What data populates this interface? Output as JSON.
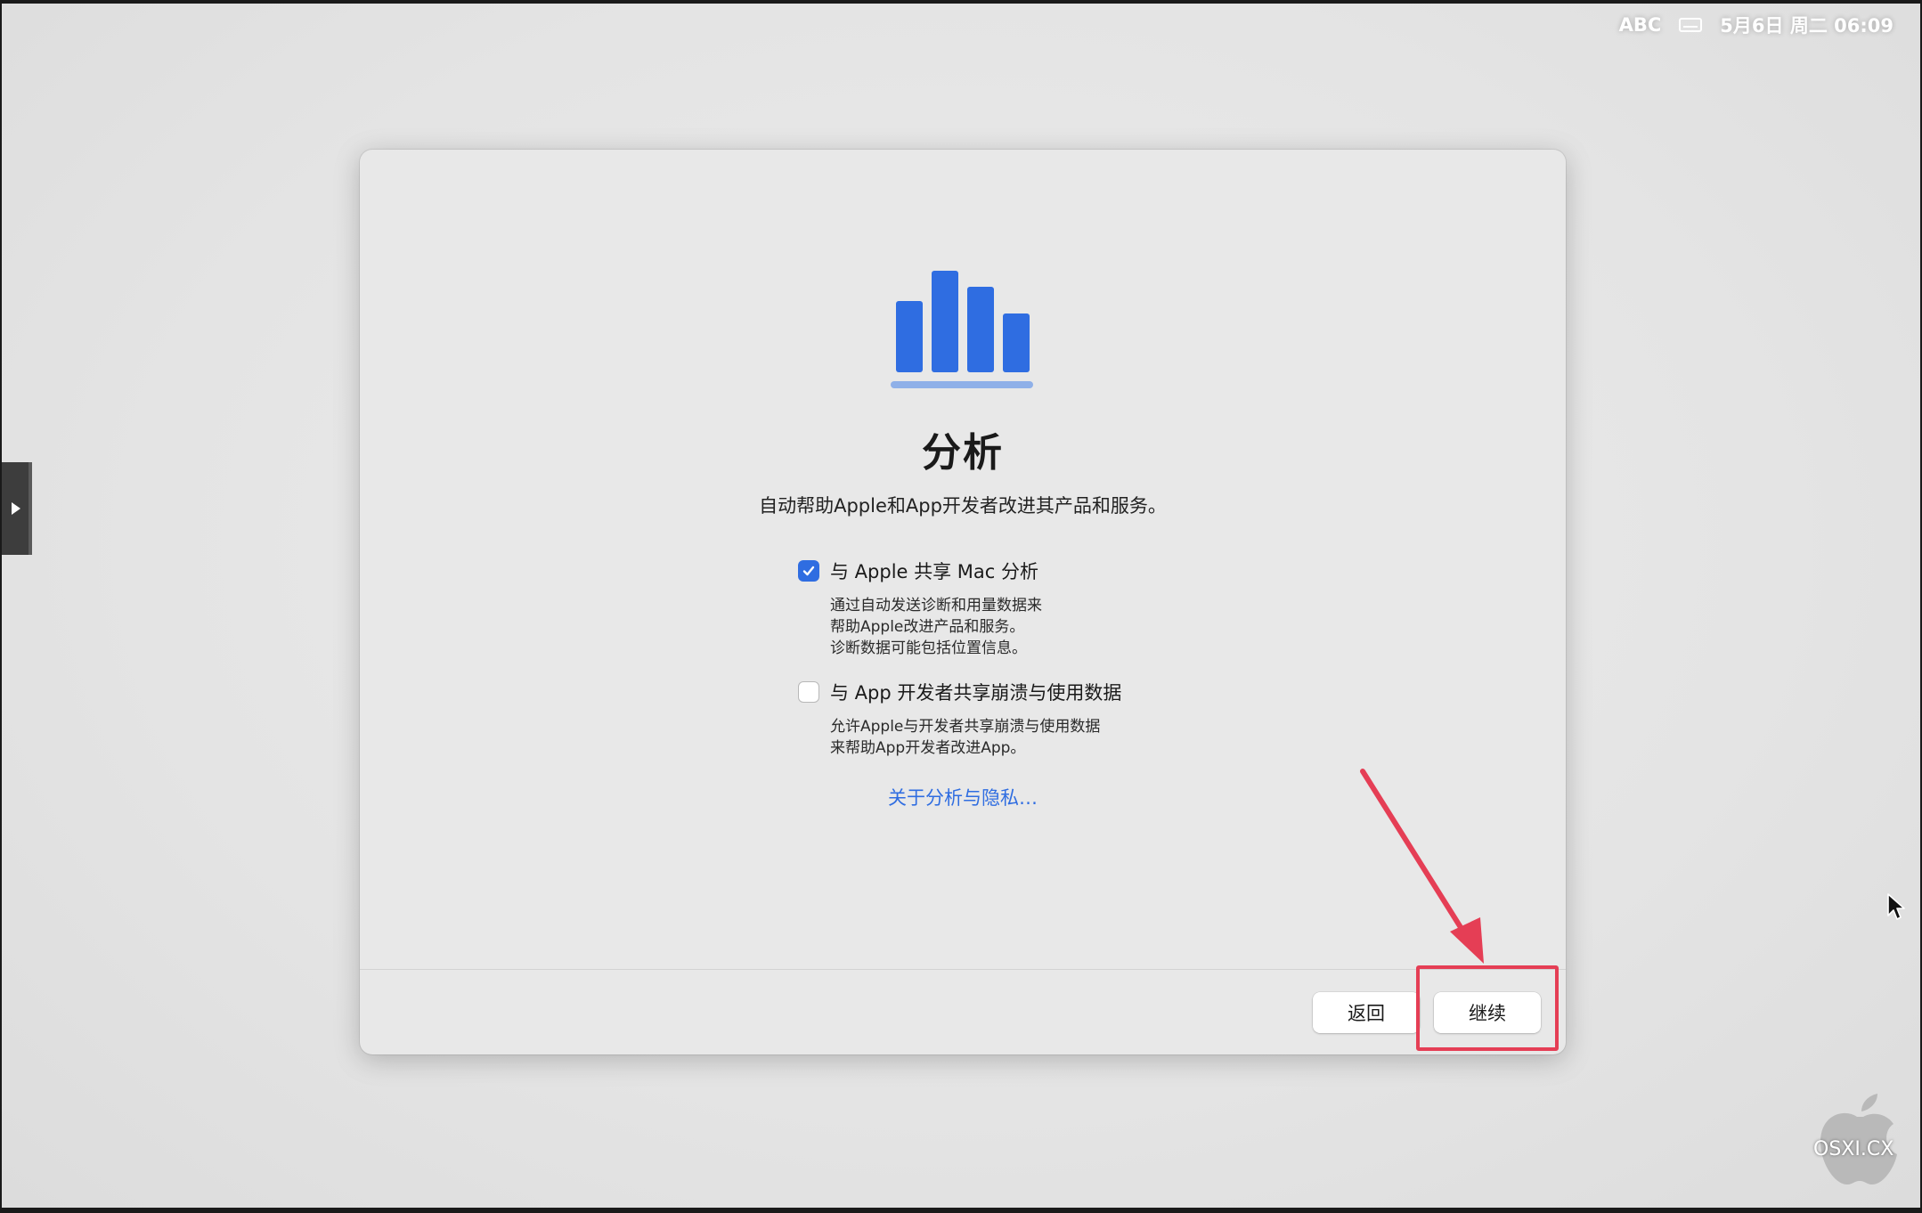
{
  "menubar": {
    "input_source": "ABC",
    "input_icon": "keyboard-icon",
    "datetime": "5月6日 周二 06:09"
  },
  "dialog": {
    "icon": "bar-chart-icon",
    "title": "分析",
    "subtitle": "自动帮助Apple和App开发者改进其产品和服务。",
    "options": [
      {
        "label": "与 Apple 共享 Mac 分析",
        "checked": true,
        "description": [
          "通过自动发送诊断和用量数据来",
          "帮助Apple改进产品和服务。",
          "诊断数据可能包括位置信息。"
        ]
      },
      {
        "label": "与 App 开发者共享崩溃与使用数据",
        "checked": false,
        "description": [
          "允许Apple与开发者共享崩溃与使用数据",
          "来帮助App开发者改进App。"
        ]
      }
    ],
    "privacy_link": "关于分析与隐私…",
    "buttons": {
      "back": "返回",
      "continue": "继续"
    }
  },
  "watermark": {
    "text": "OSXI.CX"
  },
  "colors": {
    "accent": "#2f6de1",
    "highlight": "#e53e55",
    "chart_bars": "#2f6de1",
    "chart_base": "#8fb0e8"
  }
}
